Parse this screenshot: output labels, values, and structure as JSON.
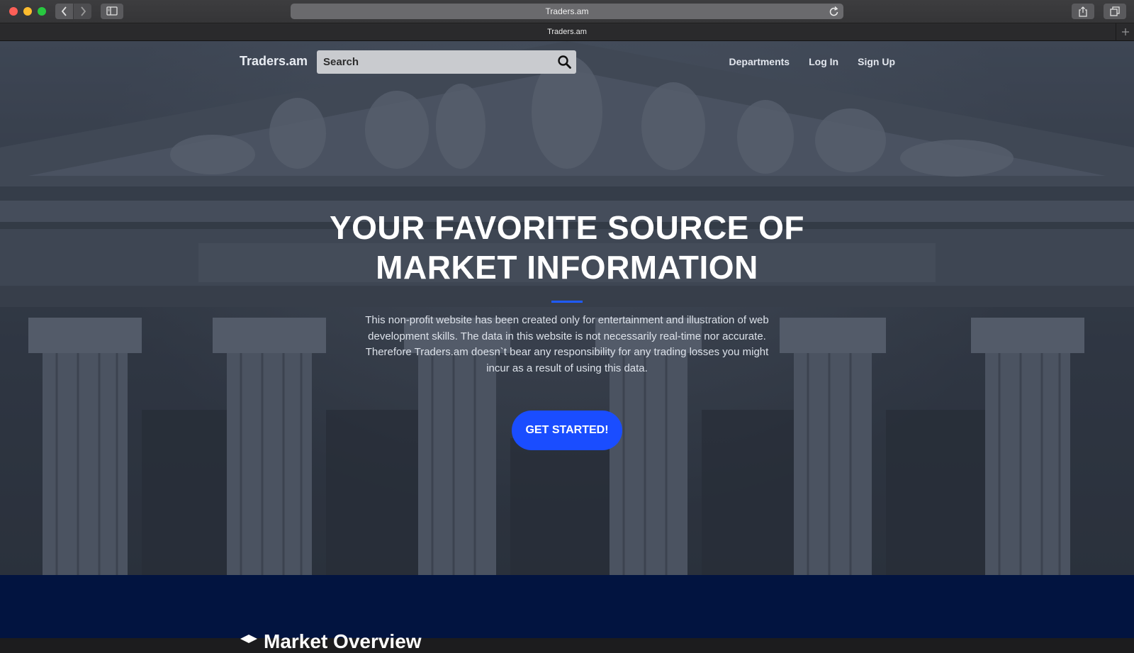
{
  "browser": {
    "url_text": "Traders.am",
    "tab_title": "Traders.am"
  },
  "site": {
    "brand": "Traders.am",
    "search": {
      "placeholder": "Search"
    },
    "nav": [
      "Departments",
      "Log In",
      "Sign Up"
    ]
  },
  "hero": {
    "headline_line1": "YOUR FAVORITE SOURCE OF",
    "headline_line2": "MARKET INFORMATION",
    "blurb": "This non-profit website has been created only for entertainment and illustration of web development skills. The data in this website is not necessarily real-time nor accurate. Therefore Traders.am doesn`t bear any responsibility for any trading losses you might incur as a result of using this data.",
    "cta_label": "GET STARTED!",
    "accent_color": "#1a4dff"
  },
  "overview": {
    "title": "Market Overview",
    "icon": "cube-icon",
    "background": "#021440"
  }
}
